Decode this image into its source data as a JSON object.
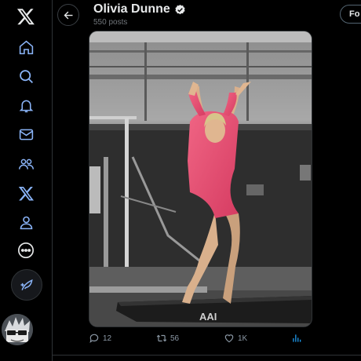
{
  "header": {
    "name": "Olivia Dunne",
    "posts_count": "550 posts",
    "follow_label": "Fo"
  },
  "nav": {
    "items": [
      {
        "icon": "x-logo-icon"
      },
      {
        "icon": "home-icon"
      },
      {
        "icon": "search-icon"
      },
      {
        "icon": "bell-icon"
      },
      {
        "icon": "mail-icon"
      },
      {
        "icon": "communities-icon"
      },
      {
        "icon": "premium-x-icon"
      },
      {
        "icon": "profile-icon"
      },
      {
        "icon": "more-icon"
      },
      {
        "icon": "compose-post-icon"
      }
    ]
  },
  "media": {
    "description_none": "",
    "mat_brand": "AAI"
  },
  "actions": {
    "replies": "12",
    "reposts": "56",
    "likes": "1K"
  },
  "colors": {
    "background": "#000000",
    "text": "#e7e9ea",
    "muted": "#71767b",
    "verified": "#e7e9ea",
    "leotard": "#e94a6e"
  }
}
